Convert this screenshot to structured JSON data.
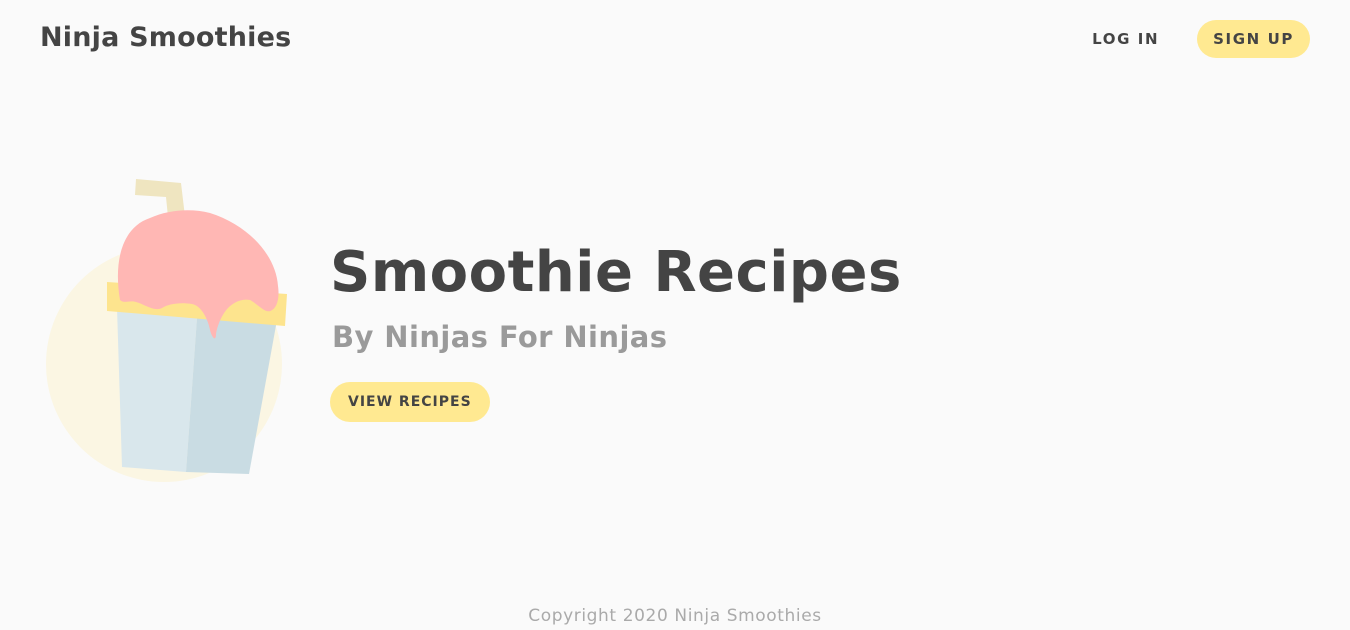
{
  "header": {
    "brand": "Ninja Smoothies",
    "login_label": "LOG IN",
    "signup_label": "SIGN UP"
  },
  "hero": {
    "title": "Smoothie Recipes",
    "subtitle": "By Ninjas For Ninjas",
    "cta_label": "VIEW RECIPES",
    "illustration_icon": "smoothie-cup-icon"
  },
  "footer": {
    "copyright": "Copyright 2020 Ninja Smoothies"
  },
  "colors": {
    "background": "#fafafa",
    "accent": "#ffe991",
    "text": "#444444",
    "muted": "#9a9a9a",
    "pink": "#ffb7b4",
    "cup": "#d8e6ea"
  }
}
